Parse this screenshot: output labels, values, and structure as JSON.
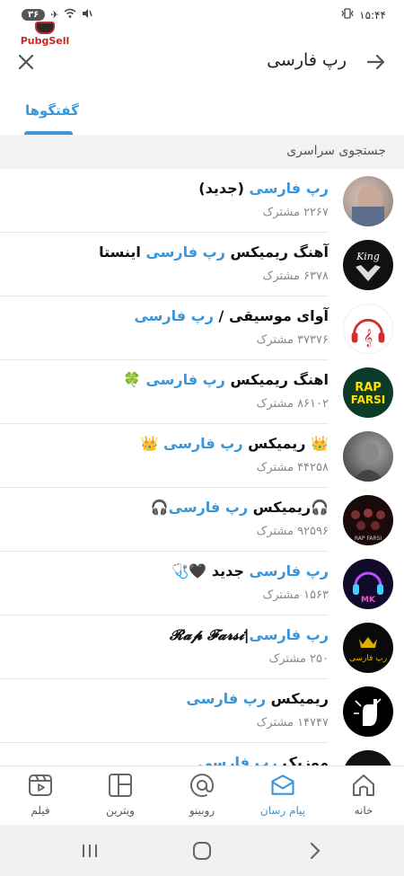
{
  "status_bar": {
    "battery": "۳۶",
    "time": "۱۵:۴۴"
  },
  "watermark": {
    "text": "PubgSell"
  },
  "header": {
    "search_query": "رپ فارسی"
  },
  "tabs": [
    {
      "label": "گفتگوها",
      "active": true
    }
  ],
  "section": {
    "title": "جستجوی سراسری"
  },
  "results": [
    {
      "pre": "",
      "hl": "رپ فارسی",
      "post": " (جدید)",
      "subscribers": "۲۲۶۷ مشترک"
    },
    {
      "pre": "آهنگ ریمیکس ",
      "hl": "رپ فارسی",
      "post": " اینستا",
      "subscribers": "۶۳۷۸ مشترک"
    },
    {
      "pre": "آوای موسیقی / ",
      "hl": "رپ فارسی",
      "post": "",
      "subscribers": "۳۷۳۷۶ مشترک"
    },
    {
      "pre": "اهنگ ریمیکس ",
      "hl": "رپ فارسی",
      "post": " 🍀",
      "subscribers": "۸۶۱۰۲ مشترک"
    },
    {
      "pre": "👑 ریمیکس ",
      "hl": "رپ فارسی",
      "post": " 👑",
      "subscribers": "۴۴۲۵۸ مشترک"
    },
    {
      "pre": "🎧ریمیکس ",
      "hl": "رپ فارسی",
      "post": "🎧",
      "subscribers": "۹۲۵۹۶ مشترک"
    },
    {
      "pre": "",
      "hl": "رپ فارسی",
      "post": " جدید 🖤🩺",
      "subscribers": "۱۵۶۳ مشترک"
    },
    {
      "pre": "",
      "hl": "رپ فارسی",
      "post": "|𝓡𝓪𝓹 𝓕𝓪𝓻𝓼𝓲",
      "subscribers": "۲۵۰ مشترک"
    },
    {
      "pre": "ریمیکس ",
      "hl": "رپ فارسی",
      "post": "",
      "subscribers": "۱۴۷۴۷ مشترک"
    },
    {
      "pre": "موزیک ",
      "hl": "رپ فارسی",
      "post": "",
      "subscribers": ""
    }
  ],
  "bottom_nav": [
    {
      "label": "خانه",
      "icon": "home-icon",
      "active": false
    },
    {
      "label": "پیام رسان",
      "icon": "messenger-icon",
      "active": true
    },
    {
      "label": "روبینو",
      "icon": "rubino-icon",
      "active": false
    },
    {
      "label": "ویترین",
      "icon": "showcase-icon",
      "active": false
    },
    {
      "label": "فیلم",
      "icon": "film-icon",
      "active": false
    }
  ],
  "colors": {
    "accent": "#3a96d8",
    "section_bg": "#f2f2f2"
  }
}
